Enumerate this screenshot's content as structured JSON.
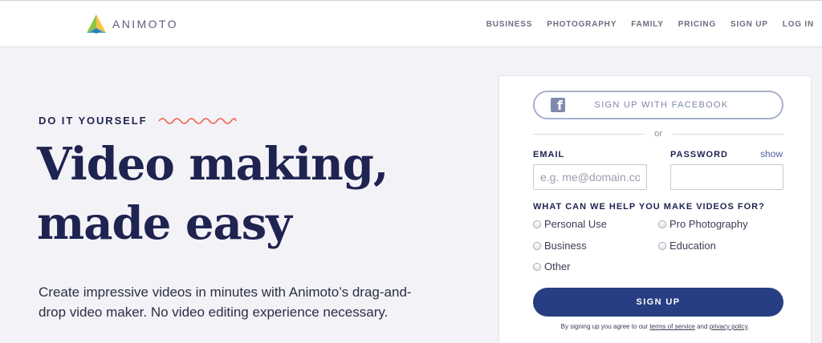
{
  "header": {
    "brand": "ANIMOTO",
    "logo_icon": "animoto-prism-icon",
    "nav": [
      "BUSINESS",
      "PHOTOGRAPHY",
      "FAMILY",
      "PRICING",
      "SIGN UP",
      "LOG IN"
    ]
  },
  "hero": {
    "kicker": "DO IT YOURSELF",
    "headline_line1": "Video making,",
    "headline_line2": "made easy",
    "subtext": "Create impressive videos in minutes with Animoto’s drag-and-drop video maker. No video editing experience necessary."
  },
  "signup": {
    "facebook_label": "SIGN UP WITH FACEBOOK",
    "or_text": "or",
    "email_label": "EMAIL",
    "email_placeholder": "e.g. me@domain.com",
    "password_label": "PASSWORD",
    "show_label": "show",
    "question": "WHAT CAN WE HELP YOU MAKE VIDEOS FOR?",
    "options": [
      "Personal Use",
      "Pro Photography",
      "Business",
      "Education",
      "Other"
    ],
    "submit_label": "SIGN UP",
    "terms_prefix": "By signing up you agree to our",
    "terms_link": "terms of service",
    "terms_and": "and",
    "privacy_link": "privacy policy",
    "terms_suffix": "."
  },
  "colors": {
    "navy": "#1f2350",
    "button": "#283e82",
    "accent": "#f26b5b",
    "background": "#f3f2f7"
  }
}
